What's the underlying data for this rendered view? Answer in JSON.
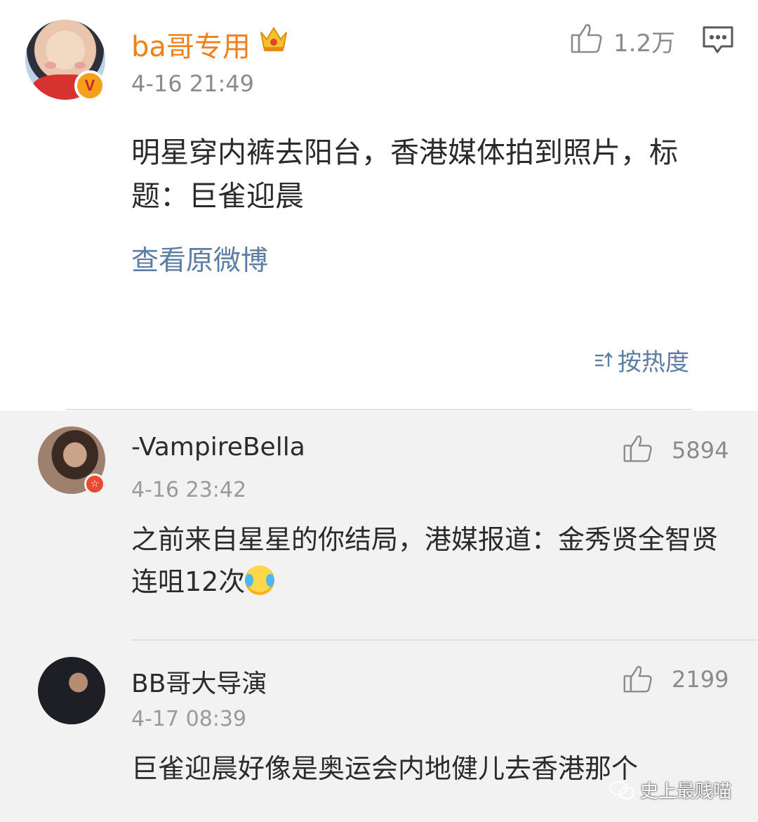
{
  "post": {
    "username": "ba哥专用",
    "timestamp": "4-16 21:49",
    "like_count": "1.2万",
    "content": "明星穿内裤去阳台，香港媒体拍到照片，标题：巨雀迎晨",
    "view_original": "查看原微博",
    "sort_label": "按热度"
  },
  "comments": [
    {
      "username": "-VampireBella",
      "timestamp": "4-16 23:42",
      "like_count": "5894",
      "content": "之前来自星星的你结局，港媒报道：金秀贤全智贤连咀12次"
    },
    {
      "username": "BB哥大导演",
      "timestamp": "4-17 08:39",
      "like_count": "2199",
      "content": "巨雀迎晨好像是奥运会内地健儿去香港那个"
    }
  ],
  "watermark": "史上最贱喵",
  "colors": {
    "username_vip": "#f0811a",
    "link": "#5d7da3",
    "comments_bg": "#f2f2f2"
  },
  "icons": {
    "verified_badge": "v-badge-icon",
    "crown": "crown-icon",
    "like": "thumbs-up-icon",
    "comment": "comment-icon",
    "sort": "sort-icon",
    "emoji": "laugh-cry-emoji"
  }
}
